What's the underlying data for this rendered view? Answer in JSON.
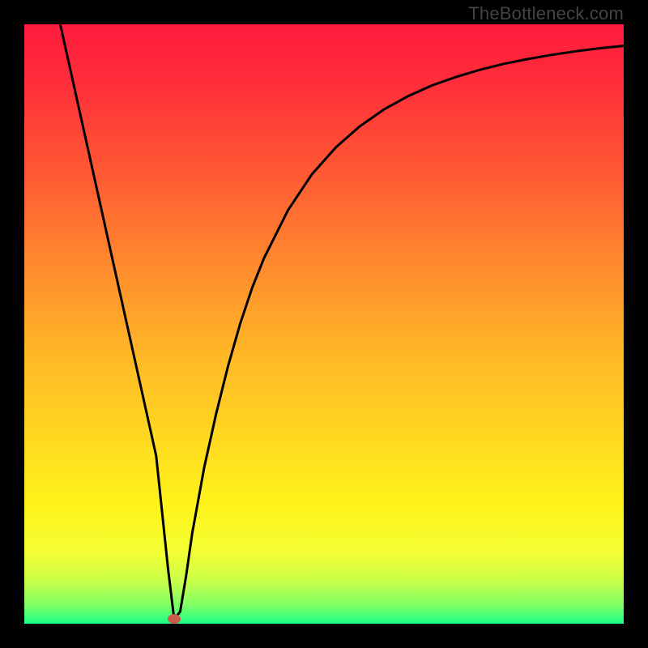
{
  "watermark": "TheBottleneck.com",
  "chart_data": {
    "type": "line",
    "title": "",
    "xlabel": "",
    "ylabel": "",
    "xlim": [
      0,
      100
    ],
    "ylim": [
      0,
      100
    ],
    "grid": false,
    "background": "red-yellow-green-vertical-gradient",
    "marker": {
      "x": 25,
      "y": 0.8,
      "color": "#cc5a4a"
    },
    "series": [
      {
        "name": "curve",
        "color": "#000000",
        "x": [
          6,
          8,
          10,
          12,
          14,
          16,
          18,
          20,
          22,
          24,
          25,
          26,
          27,
          28,
          30,
          32,
          34,
          36,
          38,
          40,
          44,
          48,
          52,
          56,
          60,
          64,
          68,
          72,
          76,
          80,
          84,
          88,
          92,
          96,
          100
        ],
        "y": [
          100,
          91,
          82,
          73,
          64,
          55,
          46,
          37,
          28,
          9,
          0.8,
          2,
          8,
          15,
          26,
          35,
          43,
          50,
          56,
          61,
          69,
          75,
          79.5,
          83,
          85.8,
          88,
          89.8,
          91.2,
          92.4,
          93.4,
          94.2,
          94.9,
          95.5,
          96,
          96.4
        ]
      }
    ]
  }
}
